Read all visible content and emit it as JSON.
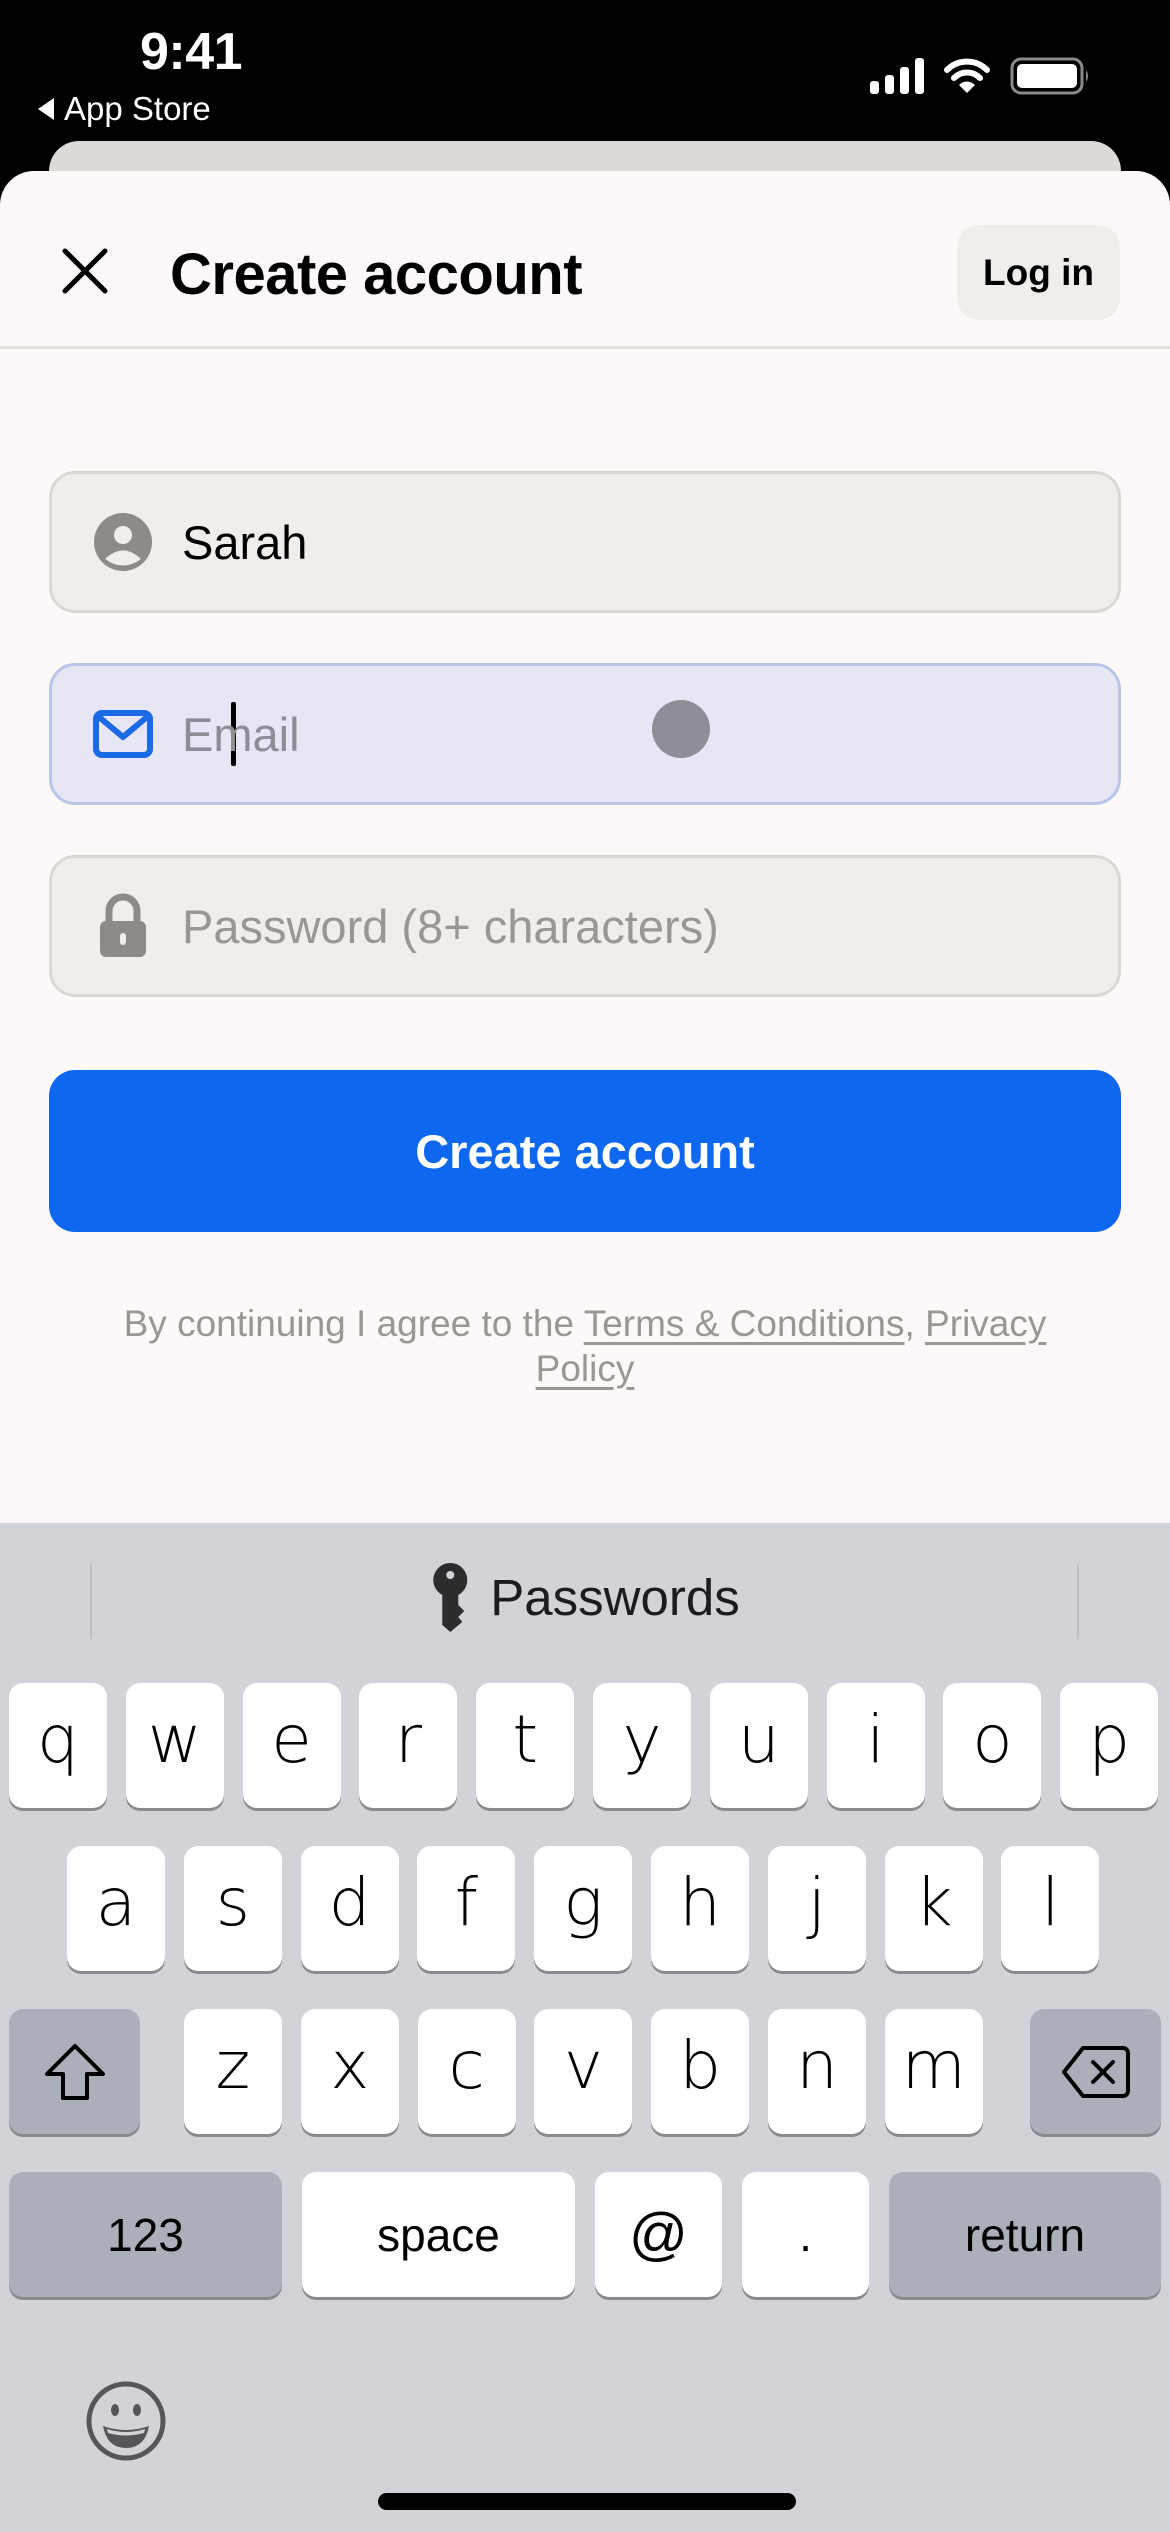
{
  "status_bar": {
    "time": "9:41",
    "back_label": "App Store",
    "icons": [
      "cellular-signal-icon",
      "wifi-icon",
      "battery-icon"
    ]
  },
  "header": {
    "close_icon": "close-icon",
    "title": "Create account",
    "login_label": "Log in"
  },
  "form": {
    "name": {
      "icon": "person-circle-icon",
      "value": "Sarah"
    },
    "email": {
      "icon": "envelope-icon",
      "value": "",
      "placeholder": "Email",
      "focused": true
    },
    "password": {
      "icon": "lock-icon",
      "value": "",
      "placeholder": "Password (8+ characters)"
    },
    "submit_label": "Create account"
  },
  "terms": {
    "prefix": "By continuing I agree to the ",
    "terms_link": "Terms & Conditions",
    "separator": ", ",
    "privacy_link": "Privacy Policy"
  },
  "colors": {
    "accent": "#0e67f0",
    "sheet_bg": "#fcf9f8",
    "field_bg": "#f1edeb",
    "focused_field_bg": "#e6e6f5",
    "keyboard_bg": "#d1d3d9"
  },
  "keyboard": {
    "suggestion": {
      "icon": "key-icon",
      "label": "Passwords"
    },
    "row1": [
      "q",
      "w",
      "e",
      "r",
      "t",
      "y",
      "u",
      "i",
      "o",
      "p"
    ],
    "row2": [
      "a",
      "s",
      "d",
      "f",
      "g",
      "h",
      "j",
      "k",
      "l"
    ],
    "row3": [
      "z",
      "x",
      "c",
      "v",
      "b",
      "n",
      "m"
    ],
    "shift_icon": "shift-icon",
    "delete_icon": "delete-icon",
    "numbers_label": "123",
    "space_label": "space",
    "at_label": "@",
    "period_label": ".",
    "return_label": "return",
    "emoji_icon": "emoji-icon"
  }
}
